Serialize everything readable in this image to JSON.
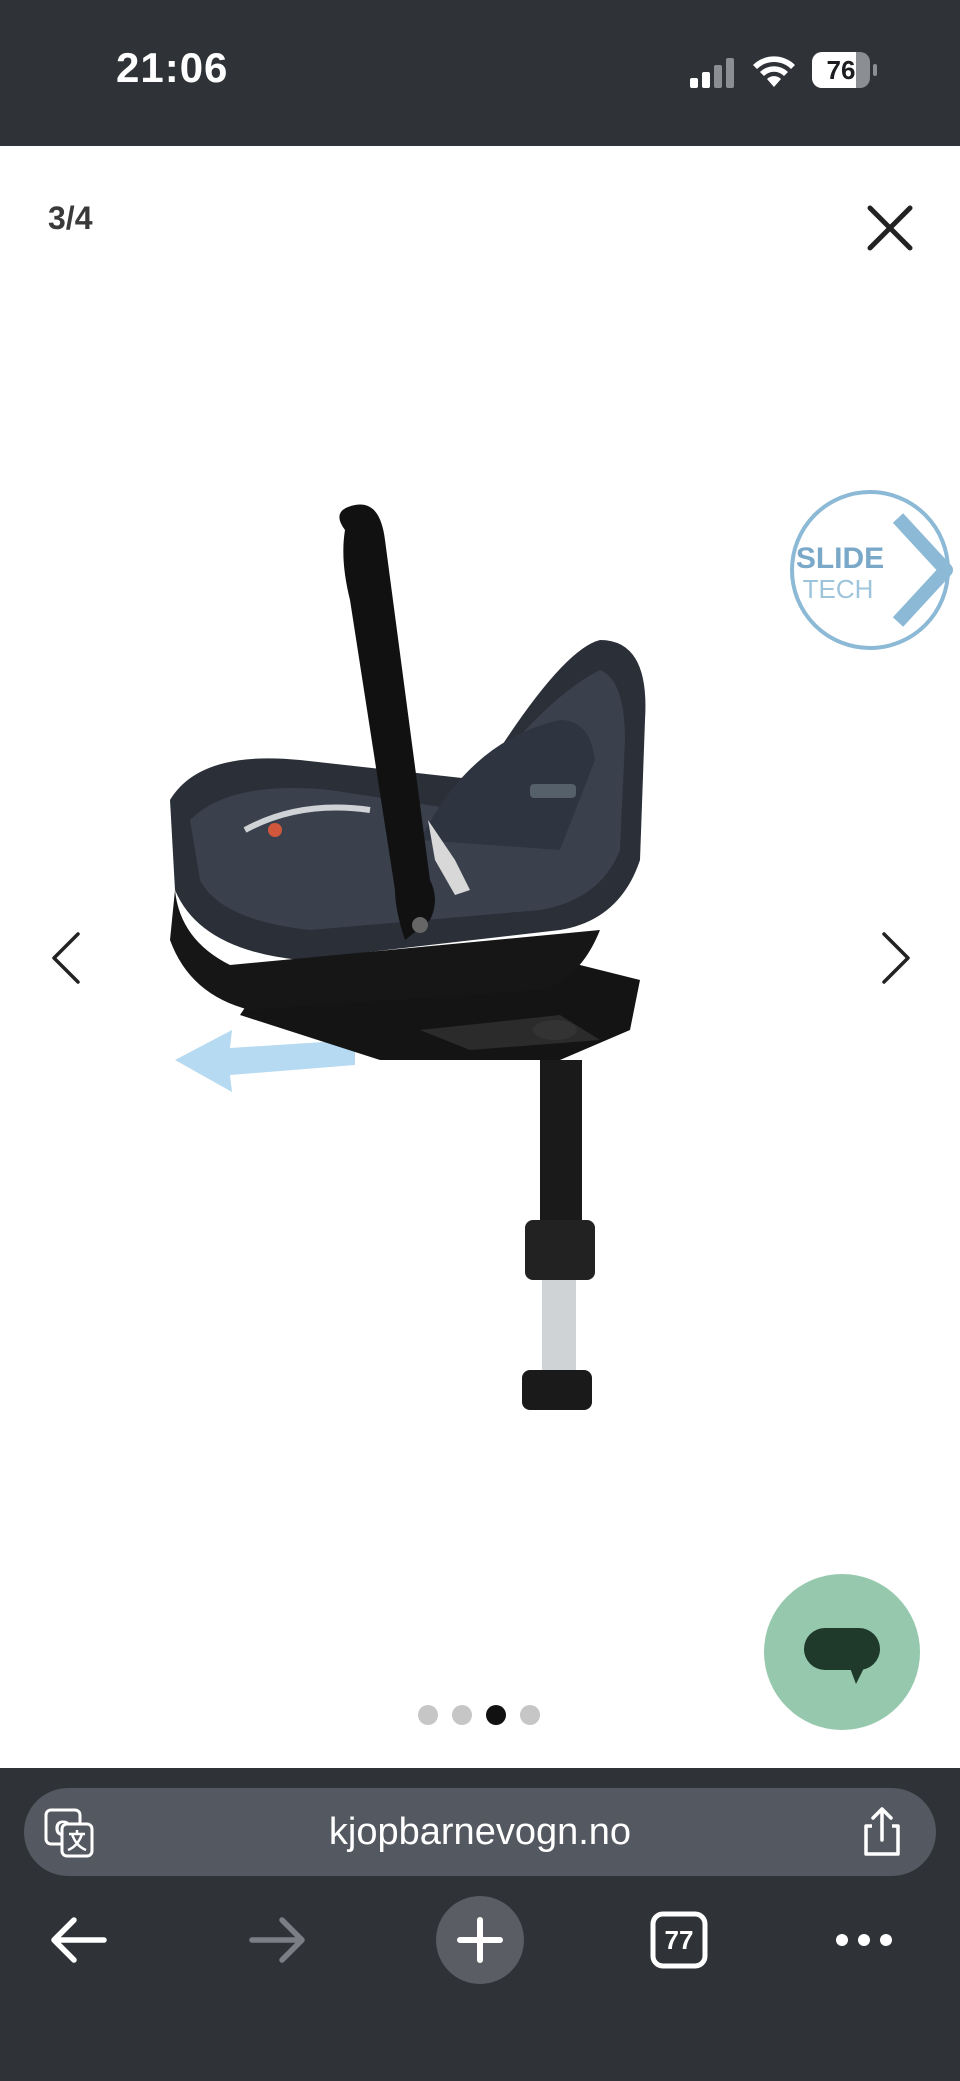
{
  "status_bar": {
    "time": "21:06",
    "battery_percent": "76",
    "battery_level": 0.76
  },
  "gallery": {
    "counter": "3/4",
    "current_index": 3,
    "total": 4
  },
  "image_overlay": {
    "badge_line1": "SLIDE",
    "badge_line2": "TECH"
  },
  "browser": {
    "url": "kjopbarnevogn.no",
    "tab_count": "77"
  },
  "colors": {
    "chrome_bg": "#2f3237",
    "url_bar_bg": "#545860",
    "chat_button": "#96c8ad",
    "badge_blue": "#8bb9d6"
  }
}
